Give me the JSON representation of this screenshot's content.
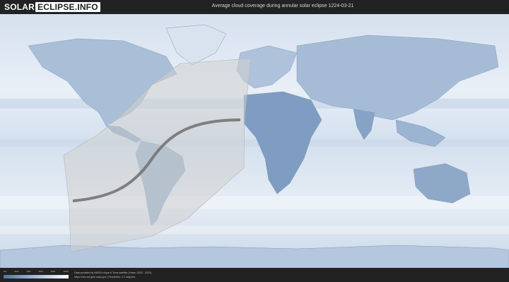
{
  "header": {
    "logo_part1": "SOLAR",
    "logo_part2": "ECLIPSE.INFO",
    "title": "Average cloud coverage during annular solar eclipse 1224-03-21"
  },
  "legend": {
    "ticks": [
      "0%",
      "20%",
      "40%",
      "60%",
      "80%",
      "100%"
    ],
    "colors": [
      "#4f74a3",
      "#89a7c8",
      "#c3d3e4",
      "#ffffff"
    ]
  },
  "footer": {
    "credit_line1": "Data provided by NASA's Aqua & Terra satellite (Years: 2003 - 2019)",
    "credit_line2": "https://neo.sci.gsfc.nasa.gov | Resolution: 0.1 degrees"
  },
  "map": {
    "ocean_color": "#dfe8f2",
    "land_color": "#8fa9c8",
    "eclipse_zone_color": "#cfcfcf",
    "central_line_color": "#6f6f6f"
  }
}
